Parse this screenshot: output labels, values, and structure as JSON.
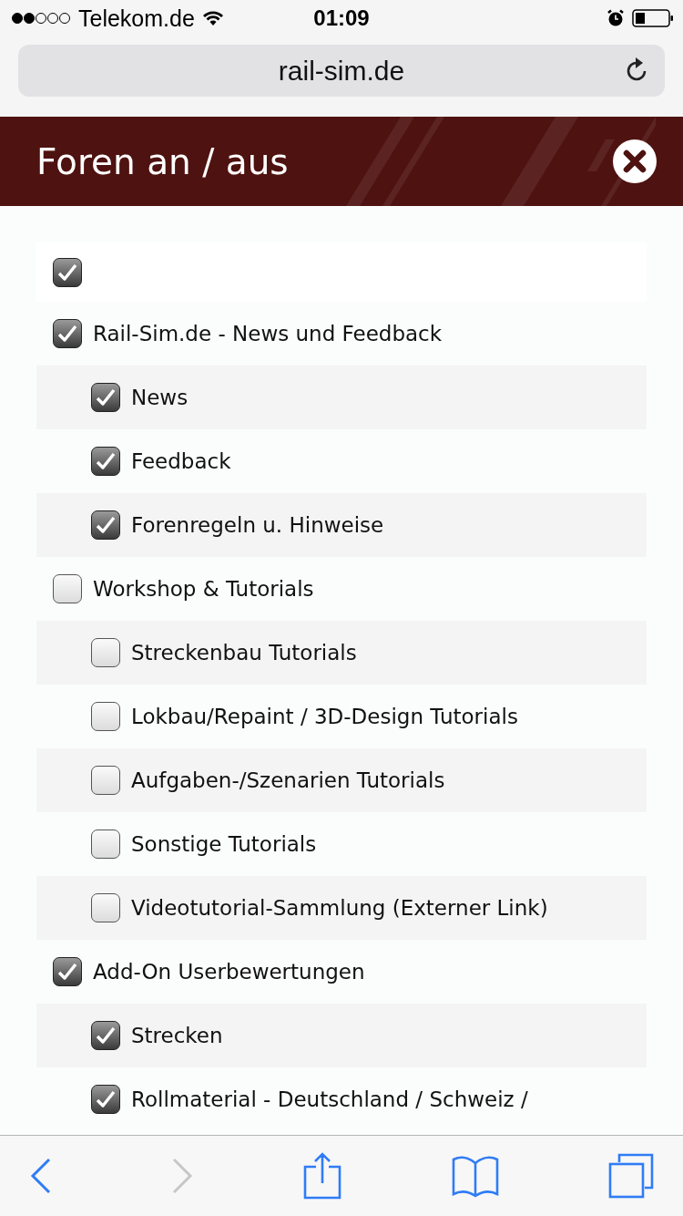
{
  "status_bar": {
    "carrier": "Telekom.de",
    "time": "01:09"
  },
  "url_bar": {
    "url": "rail-sim.de"
  },
  "header": {
    "title": "Foren an / aus"
  },
  "select_all": {
    "checked": true
  },
  "forums": [
    {
      "label": "Rail-Sim.de - News und Feedback",
      "checked": true,
      "children": [
        {
          "label": "News",
          "checked": true
        },
        {
          "label": "Feedback",
          "checked": true
        },
        {
          "label": "Forenregeln u. Hinweise",
          "checked": true
        }
      ]
    },
    {
      "label": "Workshop & Tutorials",
      "checked": false,
      "children": [
        {
          "label": "Streckenbau Tutorials",
          "checked": false
        },
        {
          "label": "Lokbau/Repaint / 3D-Design Tutorials",
          "checked": false
        },
        {
          "label": "Aufgaben-/Szenarien Tutorials",
          "checked": false
        },
        {
          "label": "Sonstige Tutorials",
          "checked": false
        },
        {
          "label": "Videotutorial-Sammlung (Externer Link)",
          "checked": false
        }
      ]
    },
    {
      "label": "Add-On Userbewertungen",
      "checked": true,
      "children": [
        {
          "label": "Strecken",
          "checked": true
        },
        {
          "label": "Rollmaterial - Deutschland / Schweiz /",
          "checked": true
        }
      ]
    }
  ]
}
